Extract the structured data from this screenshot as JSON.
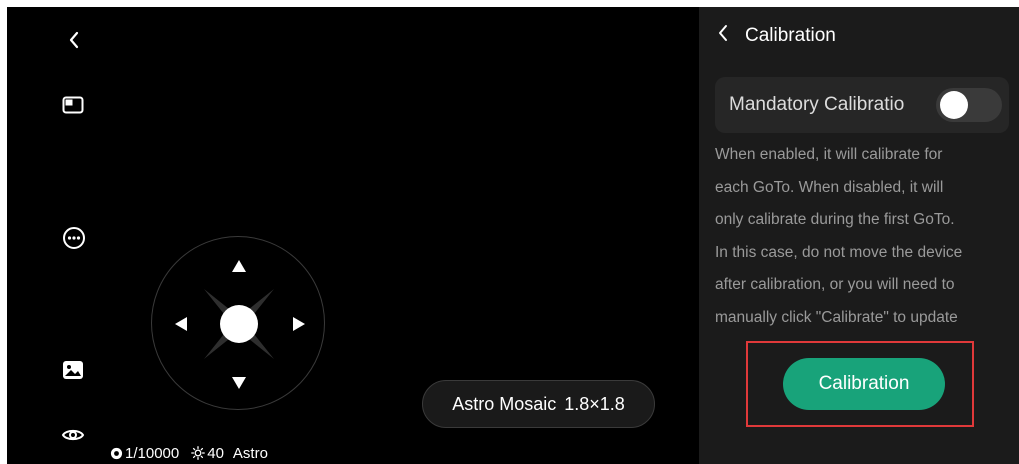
{
  "toolbar": {
    "icons": [
      "back-icon",
      "layout-icon",
      "more-icon",
      "gallery-icon",
      "eye-icon"
    ]
  },
  "joystick": {
    "icons": [
      "arrow-up-icon",
      "arrow-down-icon",
      "arrow-left-icon",
      "arrow-right-icon"
    ]
  },
  "status": {
    "shutter": "1/10000",
    "gain": "40",
    "mode": "Astro"
  },
  "mosaic": {
    "label": "Astro Mosaic",
    "size": "1.8×1.8"
  },
  "panel": {
    "title": "Calibration",
    "toggle_label": "Mandatory Calibratio",
    "toggle_on": false,
    "description_lines": [
      "When enabled, it will calibrate for",
      "each GoTo. When disabled, it will",
      "only calibrate during the first GoTo.",
      "In this case, do not move the device",
      "after calibration, or you will need to",
      "manually click \"Calibrate\" to update"
    ],
    "button_label": "Calibration"
  },
  "colors": {
    "accent_green": "#18a37a",
    "highlight_red": "#e0393a",
    "panel_bg": "#1b1b1b",
    "screen_bg": "#000000"
  }
}
